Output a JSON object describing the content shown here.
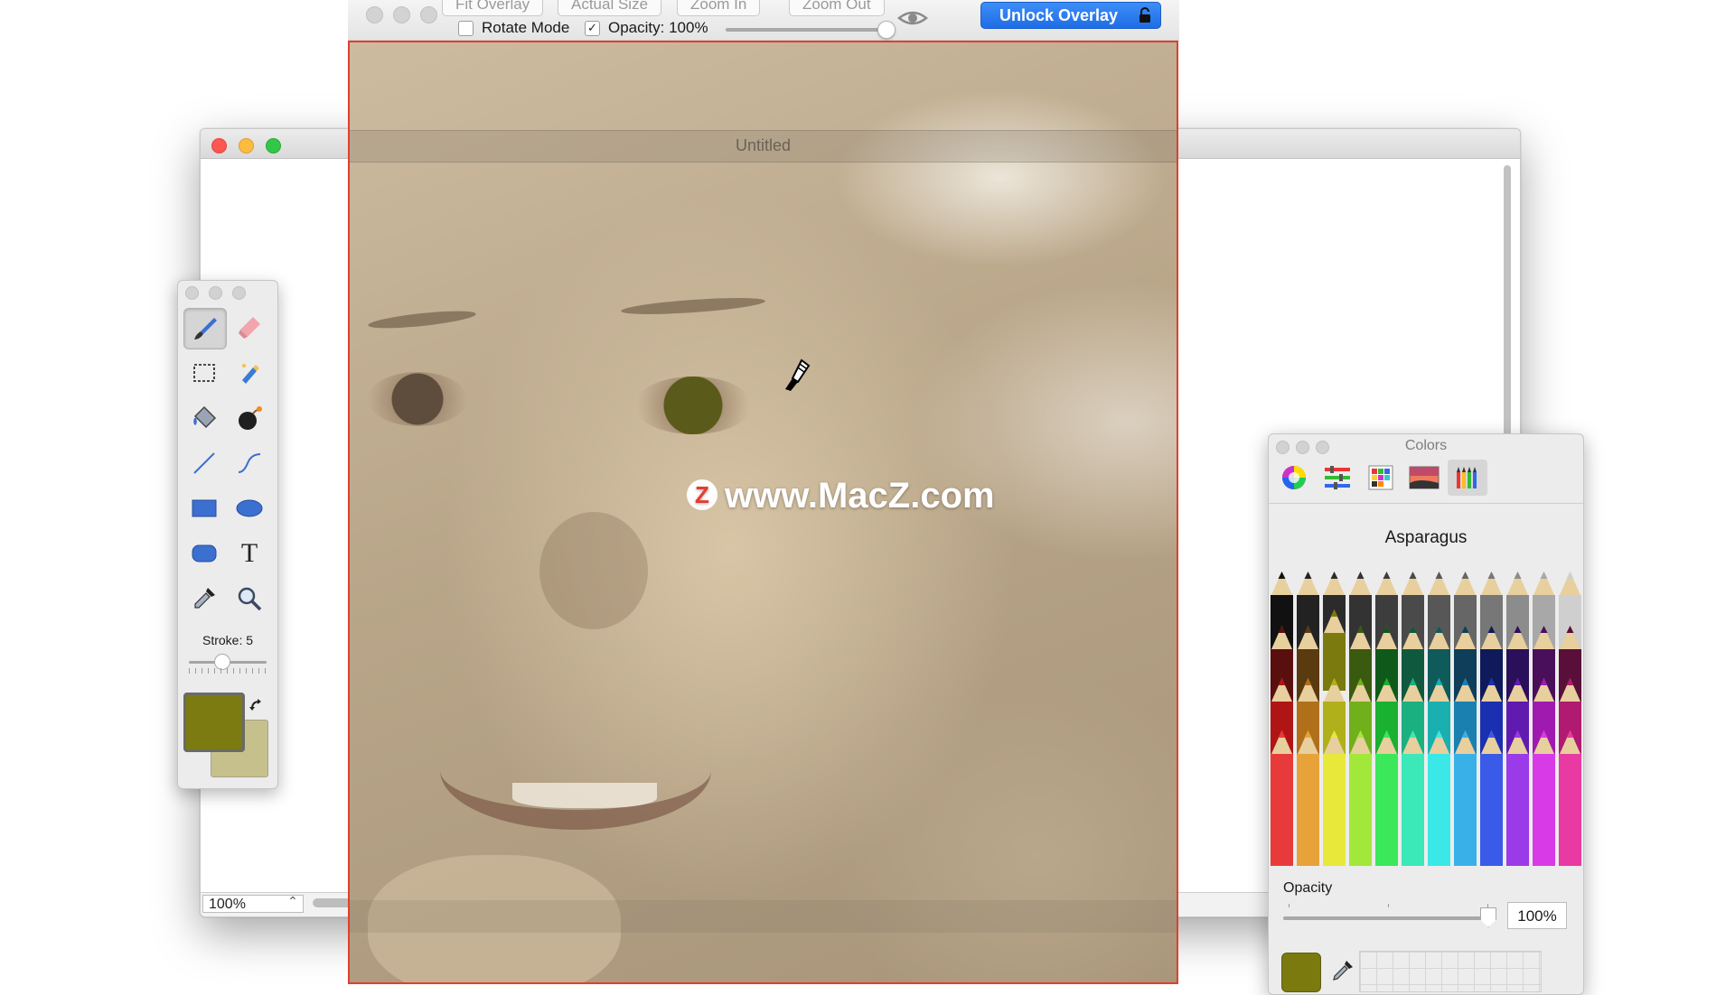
{
  "document": {
    "title": "Untitled",
    "zoom_value": "100%"
  },
  "overlay_toolbar": {
    "buttons": [
      "Fit Overlay",
      "Actual Size",
      "Zoom In",
      "Zoom Out"
    ],
    "rotate_mode_label": "Rotate Mode",
    "rotate_mode_checked": false,
    "opacity_label": "Opacity: 100%",
    "opacity_checked": true,
    "opacity_level": 1.0,
    "unlock_label": "Unlock Overlay"
  },
  "overlay": {
    "watermark_text": "www.MacZ.com",
    "watermark_logo": "Z"
  },
  "tools": {
    "items": [
      "brush",
      "eraser",
      "marquee-select",
      "magic-wand",
      "paint-bucket",
      "bomb",
      "line",
      "curve",
      "rectangle",
      "ellipse",
      "rounded-rect",
      "text",
      "eyedropper",
      "zoom"
    ],
    "selected": "brush",
    "text_tool_glyph": "T",
    "stroke_label": "Stroke: 5",
    "foreground_color": "#7b7b12",
    "background_color": "#c6c18c"
  },
  "colors_panel": {
    "title": "Colors",
    "tabs": [
      "color-wheel",
      "color-sliders",
      "color-palettes",
      "image-palettes",
      "pencils"
    ],
    "selected_tab": "pencils",
    "color_name": "Asparagus",
    "opacity_label": "Opacity",
    "opacity_value": "100%",
    "current_color": "#7a7a0e"
  }
}
